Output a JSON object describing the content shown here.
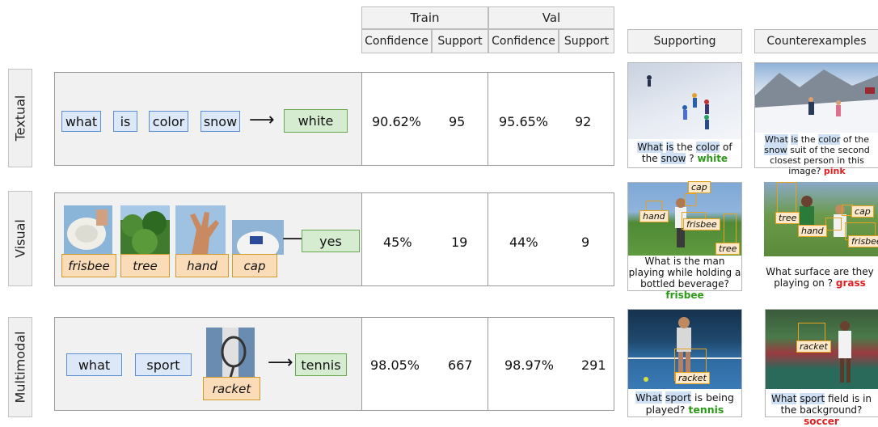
{
  "header": {
    "train": "Train",
    "val": "Val",
    "confidence": "Confidence",
    "support": "Support",
    "supporting": "Supporting",
    "counterexamples": "Counterexamples"
  },
  "rows": [
    {
      "label": "Textual",
      "tokens": [
        "what",
        "is",
        "color",
        "snow"
      ],
      "answer": "white",
      "train_conf": "90.62%",
      "train_sup": "95",
      "val_conf": "95.65%",
      "val_sup": "92",
      "supporting": {
        "caption": [
          [
            "What",
            true
          ],
          [
            " ",
            false
          ],
          [
            "is",
            true
          ],
          [
            " the ",
            false
          ],
          [
            "color",
            true
          ],
          [
            " of the ",
            false
          ],
          [
            "snow",
            true
          ],
          [
            " ? ",
            false
          ]
        ],
        "answer": "white"
      },
      "counter": {
        "caption": [
          [
            "What",
            true
          ],
          [
            " ",
            false
          ],
          [
            "is",
            true
          ],
          [
            " the ",
            false
          ],
          [
            "color",
            true
          ],
          [
            " of the ",
            false
          ],
          [
            "snow",
            true
          ],
          [
            " suit of the second closest person in this image? ",
            false
          ]
        ],
        "answer": "pink"
      }
    },
    {
      "label": "Visual",
      "objects": [
        "frisbee",
        "tree",
        "hand",
        "cap"
      ],
      "answer": "yes",
      "train_conf": "45%",
      "train_sup": "19",
      "val_conf": "44%",
      "val_sup": "9",
      "supporting": {
        "caption_text": "What is the man playing while holding a bottled beverage? ",
        "answer": "frisbee",
        "boxes": [
          "cap",
          "hand",
          "frisbee",
          "tree"
        ]
      },
      "counter": {
        "caption_text": "What surface are they playing on ? ",
        "answer": "grass",
        "boxes": [
          "tree",
          "cap",
          "hand",
          "frisbee"
        ]
      }
    },
    {
      "label": "Multimodal",
      "tokens": [
        "what",
        "sport"
      ],
      "object": "racket",
      "answer": "tennis",
      "train_conf": "98.05%",
      "train_sup": "667",
      "val_conf": "98.97%",
      "val_sup": "291",
      "supporting": {
        "caption": [
          [
            "What",
            true
          ],
          [
            " ",
            false
          ],
          [
            "sport",
            true
          ],
          [
            " is being played? ",
            false
          ]
        ],
        "answer": "tennis",
        "boxes": [
          "racket"
        ]
      },
      "counter": {
        "caption": [
          [
            "What",
            true
          ],
          [
            " ",
            false
          ],
          [
            "sport",
            true
          ],
          [
            " field is in the background? ",
            false
          ]
        ],
        "answer": "soccer",
        "boxes": [
          "racket"
        ]
      }
    }
  ],
  "colors": {
    "token_blue": "#dce8f8",
    "token_green": "#d6ecd0",
    "token_orange": "#fbdcb8",
    "answer_green": "#2e9a1a",
    "answer_red": "#e02020"
  }
}
